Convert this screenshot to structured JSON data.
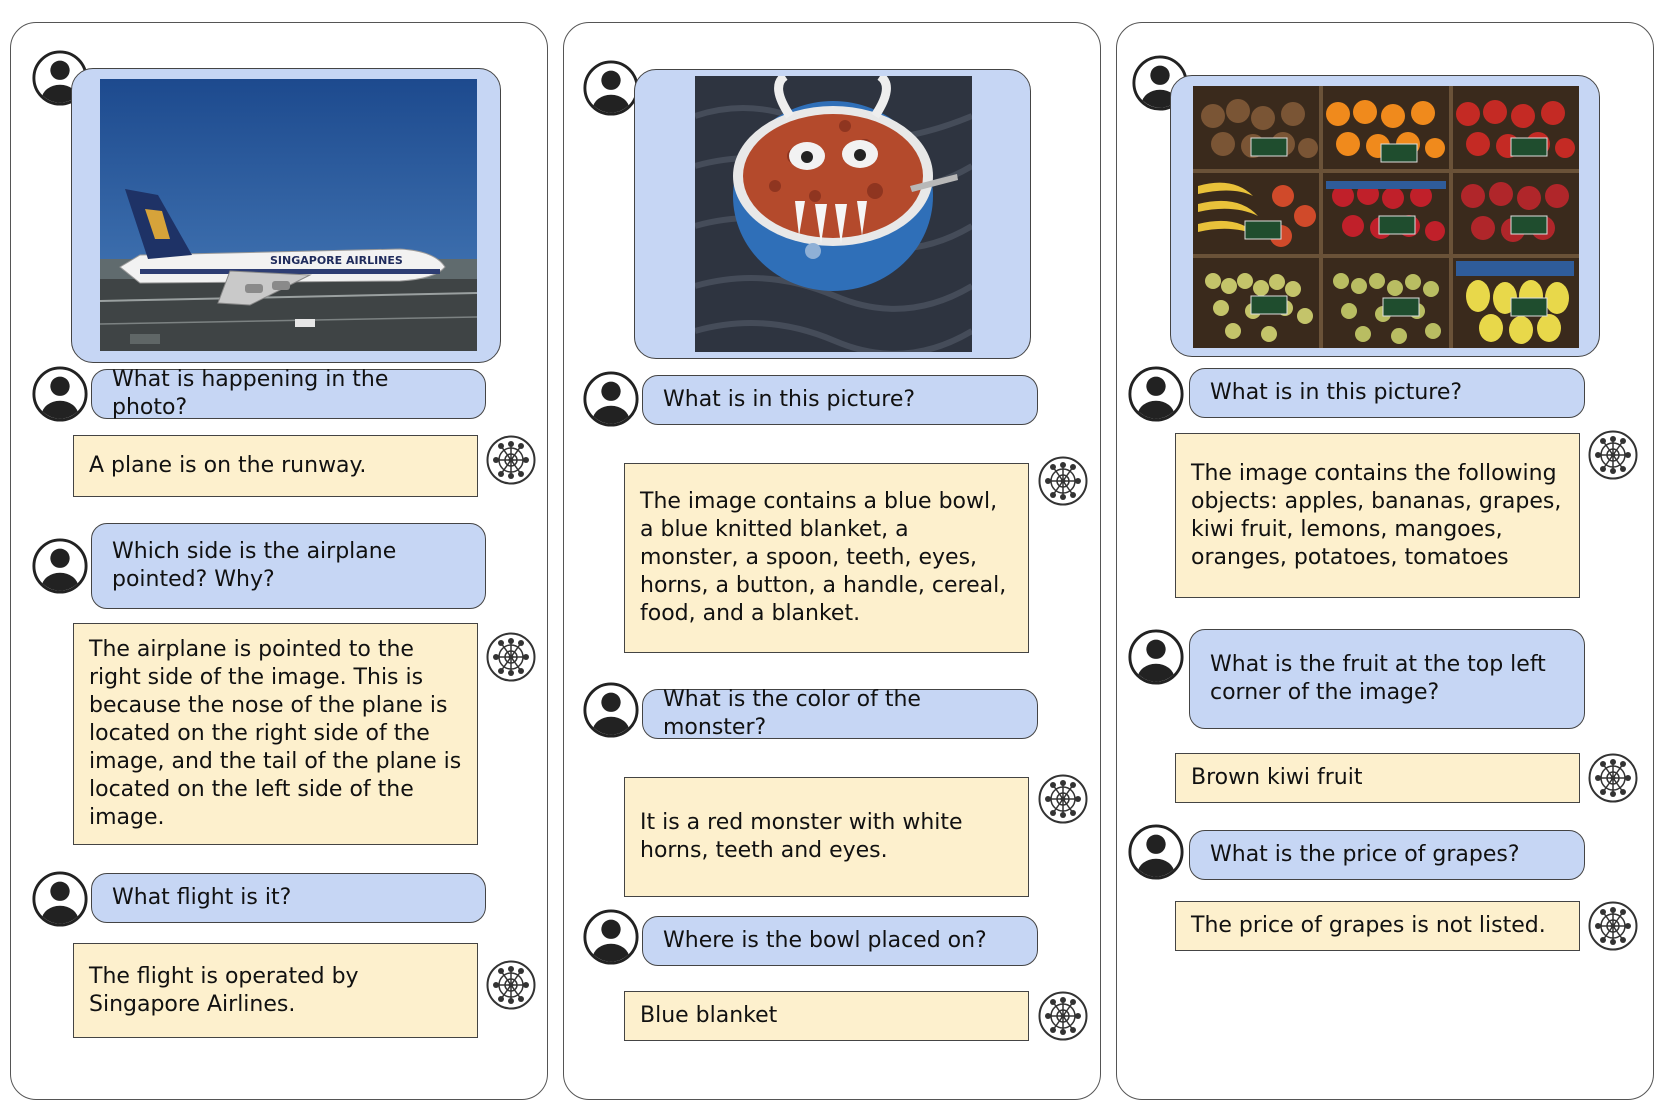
{
  "colors": {
    "question_bubble": "#c6d6f4",
    "answer_box": "#fdf0cd",
    "border": "#444444"
  },
  "panels": [
    {
      "image_subject": "Singapore Airlines airplane on runway",
      "image_text": "SINGAPORE AIRLINES",
      "turns": [
        {
          "question": "What is happening in the photo?",
          "answer": "A plane is on the runway."
        },
        {
          "question": "Which side is the airplane pointed? Why?",
          "answer": "The airplane is pointed to the right side of the image. This is because the nose of the plane is located on the right side of the image, and the tail of the plane is located on the left side of the image."
        },
        {
          "question": "What flight is it?",
          "answer": "The flight is operated by Singapore Airlines."
        }
      ]
    },
    {
      "image_subject": "monster-faced cereal bowl on knitted blanket",
      "turns": [
        {
          "question": "What is in this picture?",
          "answer": "The image contains a blue bowl, a blue knitted blanket, a monster, a spoon, teeth, eyes, horns, a button, a handle, cereal, food, and a blanket."
        },
        {
          "question": "What is the color of the monster?",
          "answer": "It is a red monster with white horns, teeth and eyes."
        },
        {
          "question": "Where is the bowl placed on?",
          "answer": "Blue blanket"
        }
      ]
    },
    {
      "image_subject": "fruit market stall",
      "turns": [
        {
          "question": "What is in this picture?",
          "answer": "The image contains the following objects: apples, bananas, grapes, kiwi fruit, lemons, mangoes, oranges, potatoes, tomatoes"
        },
        {
          "question": "What is the fruit at the top left corner of the image?",
          "answer": "Brown kiwi fruit"
        },
        {
          "question": "What is the price of grapes?",
          "answer": "The price of grapes is not listed."
        }
      ]
    }
  ],
  "icons": {
    "user": "user-avatar-icon",
    "model": "model-logo-icon"
  }
}
